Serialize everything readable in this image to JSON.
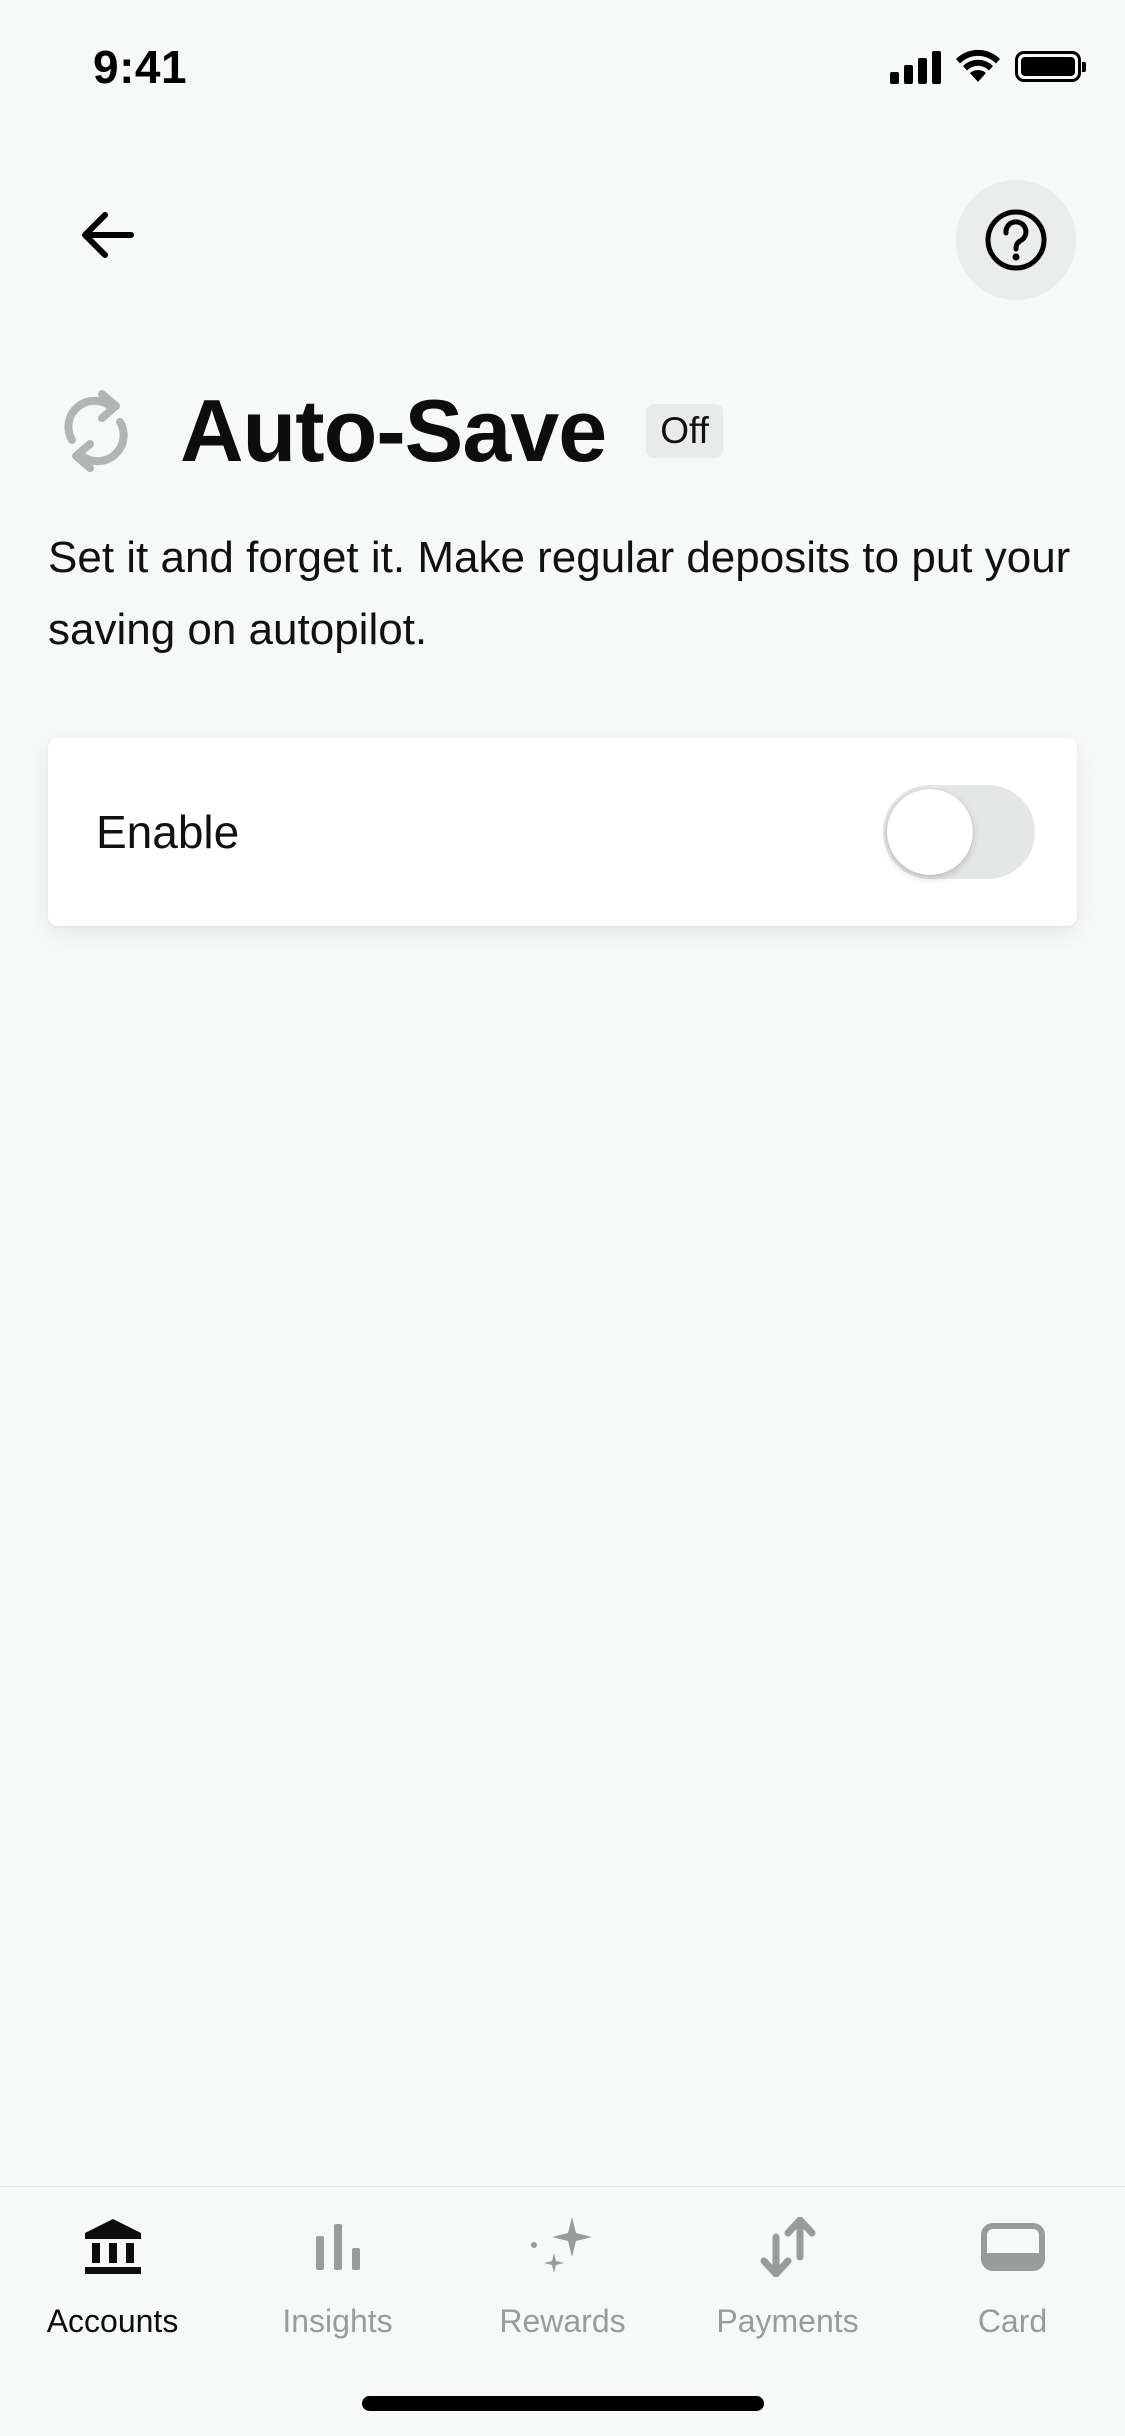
{
  "status_bar": {
    "time": "9:41"
  },
  "header": {
    "back_label": "",
    "help_label": ""
  },
  "title": {
    "text": "Auto-Save",
    "badge": "Off"
  },
  "description": "Set it and forget it. Make regular deposits to put your saving on autopilot.",
  "enable_card": {
    "label": "Enable",
    "toggle_on": false
  },
  "tab_bar": {
    "items": [
      {
        "label": "Accounts",
        "icon": "bank-icon",
        "active": true
      },
      {
        "label": "Insights",
        "icon": "bar-chart-icon",
        "active": false
      },
      {
        "label": "Rewards",
        "icon": "sparkle-icon",
        "active": false
      },
      {
        "label": "Payments",
        "icon": "transfer-arrows-icon",
        "active": false
      },
      {
        "label": "Card",
        "icon": "card-icon",
        "active": false
      }
    ]
  },
  "colors": {
    "background": "#f7f8f8",
    "inactive_tab": "#9a9b9b",
    "active_tab": "#0d0d0d",
    "toggle_track": "#e5e6e6"
  }
}
